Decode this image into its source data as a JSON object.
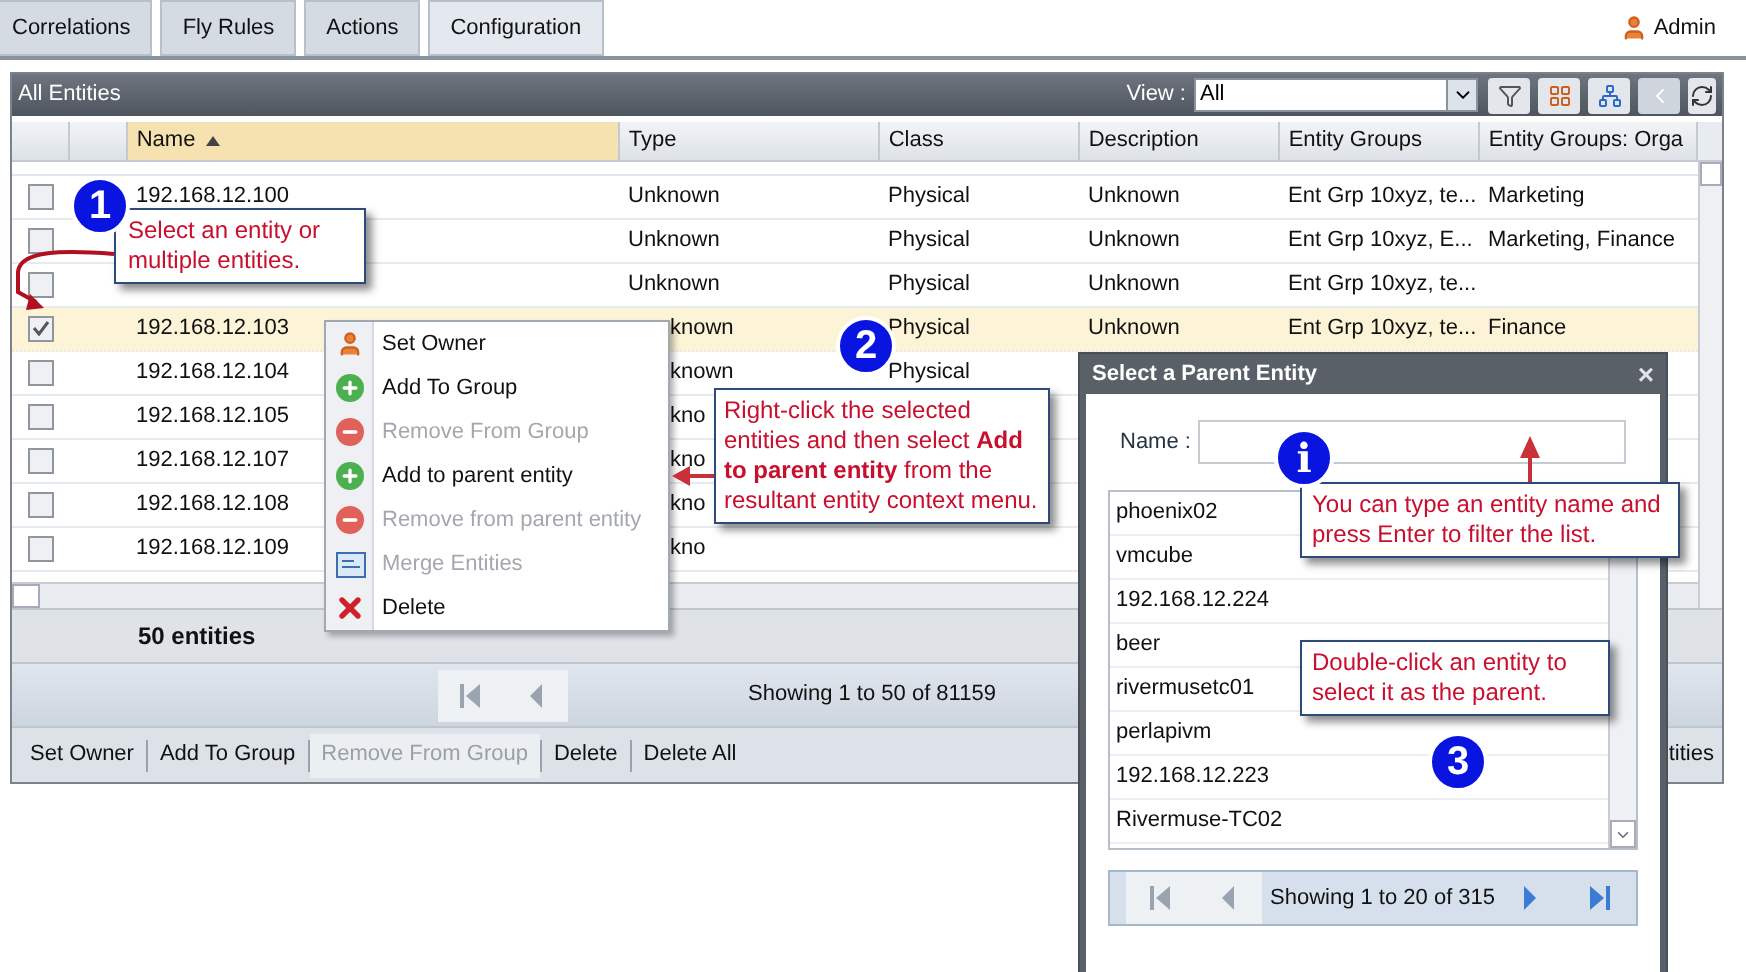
{
  "tabs": [
    {
      "label": "Correlations",
      "selected": false
    },
    {
      "label": "Fly Rules",
      "selected": false
    },
    {
      "label": "Actions",
      "selected": false
    },
    {
      "label": "Configuration",
      "selected": true
    }
  ],
  "user": {
    "name": "Admin"
  },
  "panel": {
    "title": "All Entities",
    "view_label": "View :",
    "view_value": "All"
  },
  "table": {
    "columns": [
      {
        "label": "Name",
        "sorted": true
      },
      {
        "label": "Type",
        "sorted": false
      },
      {
        "label": "Class",
        "sorted": false
      },
      {
        "label": "Description",
        "sorted": false
      },
      {
        "label": "Entity Groups",
        "sorted": false
      },
      {
        "label": "Entity Groups: Orga",
        "sorted": false
      }
    ],
    "rows": [
      {
        "checked": false,
        "selected": false,
        "cells": [
          "192.168.12.100",
          "Unknown",
          "Physical",
          "Unknown",
          "Ent Grp 10xyz, te...",
          "Marketing"
        ]
      },
      {
        "checked": false,
        "selected": false,
        "cells": [
          "",
          "Unknown",
          "Physical",
          "Unknown",
          "Ent Grp 10xyz, E...",
          "Marketing, Finance"
        ]
      },
      {
        "checked": false,
        "selected": false,
        "cells": [
          "",
          "Unknown",
          "Physical",
          "Unknown",
          "Ent Grp 10xyz, te...",
          ""
        ]
      },
      {
        "checked": true,
        "selected": true,
        "cells": [
          "192.168.12.103",
          "known",
          "Physical",
          "Unknown",
          "Ent Grp 10xyz, te...",
          "Finance"
        ]
      },
      {
        "checked": false,
        "selected": false,
        "cells": [
          "192.168.12.104",
          "known",
          "Physical",
          "",
          "",
          ""
        ]
      },
      {
        "checked": false,
        "selected": false,
        "cells": [
          "192.168.12.105",
          "kno",
          "",
          "",
          "",
          ""
        ]
      },
      {
        "checked": false,
        "selected": false,
        "cells": [
          "192.168.12.107",
          "kno",
          "",
          "",
          "",
          ""
        ]
      },
      {
        "checked": false,
        "selected": false,
        "cells": [
          "192.168.12.108",
          "kno",
          "",
          "",
          "",
          ""
        ]
      },
      {
        "checked": false,
        "selected": false,
        "cells": [
          "192.168.12.109",
          "kno",
          "",
          "",
          "",
          ""
        ]
      }
    ],
    "footer": "50 entities",
    "pager": "Showing 1 to 50 of 81159"
  },
  "toolbar": [
    {
      "label": "Set Owner",
      "disabled": false
    },
    {
      "label": "Add To Group",
      "disabled": false
    },
    {
      "label": "Remove From Group",
      "disabled": true
    },
    {
      "label": "Delete",
      "disabled": false
    },
    {
      "label": "Delete All",
      "disabled": false
    }
  ],
  "toolbar_tail": "tities",
  "context_menu": [
    {
      "kind": "owner",
      "label": "Set Owner",
      "disabled": false
    },
    {
      "kind": "add",
      "label": "Add To Group",
      "disabled": false
    },
    {
      "kind": "remove",
      "label": "Remove From Group",
      "disabled": true
    },
    {
      "kind": "add",
      "label": "Add to parent entity",
      "disabled": false
    },
    {
      "kind": "remove",
      "label": "Remove from parent entity",
      "disabled": true
    },
    {
      "kind": "merge",
      "label": "Merge Entities",
      "disabled": true
    },
    {
      "kind": "delete",
      "label": "Delete",
      "disabled": false
    }
  ],
  "dialog": {
    "title": "Select a Parent Entity",
    "close": "×",
    "name_label": "Name :",
    "items": [
      "phoenix02",
      "vmcube",
      "192.168.12.224",
      "beer",
      "rivermusetc01",
      "perlapivm",
      "192.168.12.223",
      "Rivermuse-TC02"
    ],
    "pager": "Showing 1 to 20 of 315"
  },
  "callouts": [
    {
      "badge": "1",
      "text": "Select an entity or multiple entities."
    },
    {
      "badge": "2",
      "text": "Right-click the selected entities and then select **Add to parent entity** from the resultant entity context menu."
    },
    {
      "badge": "i",
      "text": "You can type an entity name and press Enter to filter the list."
    },
    {
      "badge": "3",
      "text": "Double-click an entity to select it as the parent."
    }
  ]
}
